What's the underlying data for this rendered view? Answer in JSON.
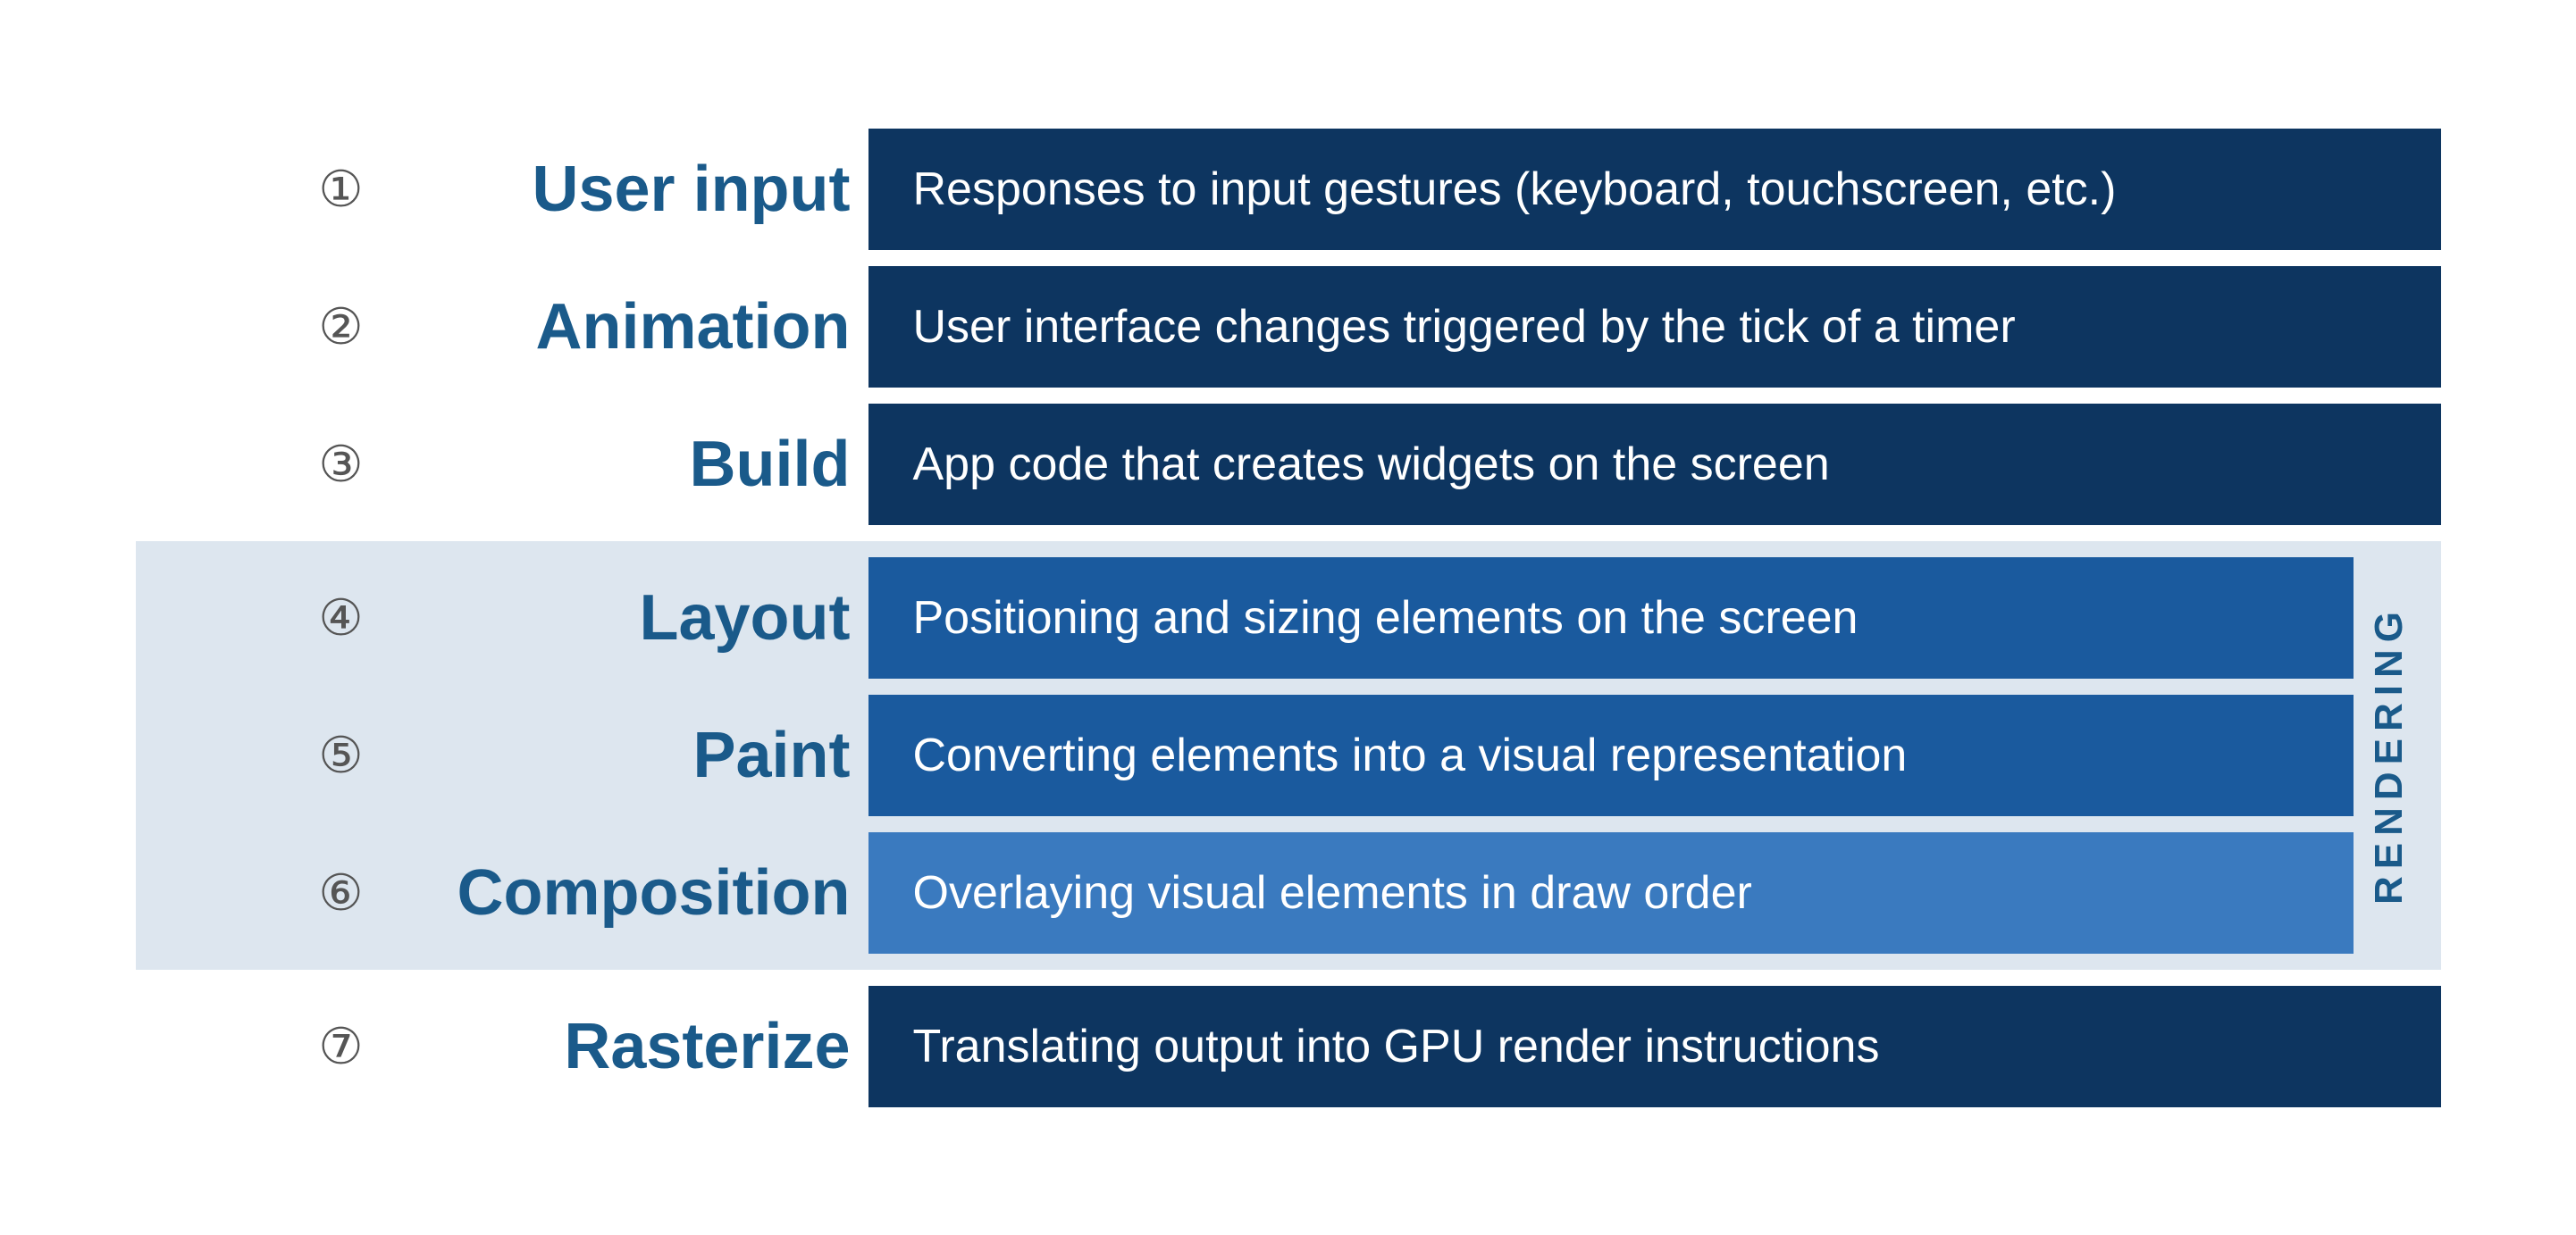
{
  "rows": [
    {
      "id": "row-1",
      "number": "①",
      "label": "User input",
      "description": "Responses to input gestures (keyboard, touchscreen, etc.)",
      "style": "dark-navy",
      "section": "none"
    },
    {
      "id": "row-2",
      "number": "②",
      "label": "Animation",
      "description": "User interface changes triggered by the tick of a timer",
      "style": "dark-navy",
      "section": "none"
    },
    {
      "id": "row-3",
      "number": "③",
      "label": "Build",
      "description": "App code that creates widgets on the screen",
      "style": "dark-navy",
      "section": "none"
    },
    {
      "id": "row-4",
      "number": "④",
      "label": "Layout",
      "description": "Positioning and sizing elements on the screen",
      "style": "medium-blue",
      "section": "rendering"
    },
    {
      "id": "row-5",
      "number": "⑤",
      "label": "Paint",
      "description": "Converting elements into a visual representation",
      "style": "medium-blue",
      "section": "rendering"
    },
    {
      "id": "row-6",
      "number": "⑥",
      "label": "Composition",
      "description": "Overlaying visual elements in draw order",
      "style": "light-blue",
      "section": "rendering"
    },
    {
      "id": "row-7",
      "number": "⑦",
      "label": "Rasterize",
      "description": "Translating output into GPU render instructions",
      "style": "dark-navy",
      "section": "none"
    }
  ],
  "rendering_label": "RENDERING"
}
